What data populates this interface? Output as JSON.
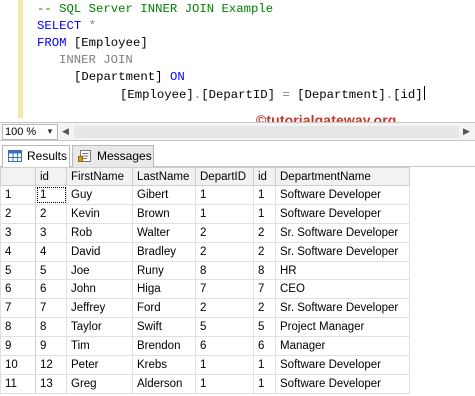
{
  "editor": {
    "lines": [
      {
        "parts": [
          {
            "cls": "cm",
            "text": "-- SQL Server INNER JOIN Example"
          }
        ]
      },
      {
        "parts": [
          {
            "cls": "kw",
            "text": "SELECT"
          },
          {
            "cls": "tx",
            "text": " "
          },
          {
            "cls": "gy",
            "text": "*"
          }
        ]
      },
      {
        "parts": [
          {
            "cls": "kw",
            "text": "FROM"
          },
          {
            "cls": "tx",
            "text": " [Employee]"
          }
        ]
      },
      {
        "parts": [
          {
            "cls": "gy",
            "text": "INNER JOIN"
          }
        ]
      },
      {
        "parts": [
          {
            "cls": "tx",
            "text": "[Department] "
          },
          {
            "cls": "kw",
            "text": "ON"
          }
        ]
      },
      {
        "parts": [
          {
            "cls": "tx",
            "text": "[Employee]"
          },
          {
            "cls": "gy",
            "text": "."
          },
          {
            "cls": "tx",
            "text": "[DepartID] "
          },
          {
            "cls": "gy",
            "text": "="
          },
          {
            "cls": "tx",
            "text": " [Department]"
          },
          {
            "cls": "gy",
            "text": "."
          },
          {
            "cls": "tx",
            "text": "[id]"
          }
        ]
      }
    ]
  },
  "watermark": "©tutorialgateway.org",
  "zoom": {
    "value": "100 %"
  },
  "tabs": [
    {
      "label": "Results",
      "icon": "grid-results-icon",
      "active": true
    },
    {
      "label": "Messages",
      "icon": "messages-icon",
      "active": false
    }
  ],
  "grid": {
    "columns": [
      "id",
      "FirstName",
      "LastName",
      "DepartID",
      "id",
      "DepartmentName"
    ],
    "rows": [
      [
        "1",
        "1",
        "Guy",
        "Gibert",
        "1",
        "1",
        "Software Developer"
      ],
      [
        "2",
        "2",
        "Kevin",
        "Brown",
        "1",
        "1",
        "Software Developer"
      ],
      [
        "3",
        "3",
        "Rob",
        "Walter",
        "2",
        "2",
        "Sr. Software Developer"
      ],
      [
        "4",
        "4",
        "David",
        "Bradley",
        "2",
        "2",
        "Sr. Software Developer"
      ],
      [
        "5",
        "5",
        "Joe",
        "Runy",
        "8",
        "8",
        "HR"
      ],
      [
        "6",
        "6",
        "John",
        "Higa",
        "7",
        "7",
        "CEO"
      ],
      [
        "7",
        "7",
        "Jeffrey",
        "Ford",
        "2",
        "2",
        "Sr. Software Developer"
      ],
      [
        "8",
        "8",
        "Taylor",
        "Swift",
        "5",
        "5",
        "Project Manager"
      ],
      [
        "9",
        "9",
        "Tim",
        "Brendon",
        "6",
        "6",
        "Manager"
      ],
      [
        "10",
        "12",
        "Peter",
        "Krebs",
        "1",
        "1",
        "Software Developer"
      ],
      [
        "11",
        "13",
        "Greg",
        "Alderson",
        "1",
        "1",
        "Software Developer"
      ]
    ]
  }
}
